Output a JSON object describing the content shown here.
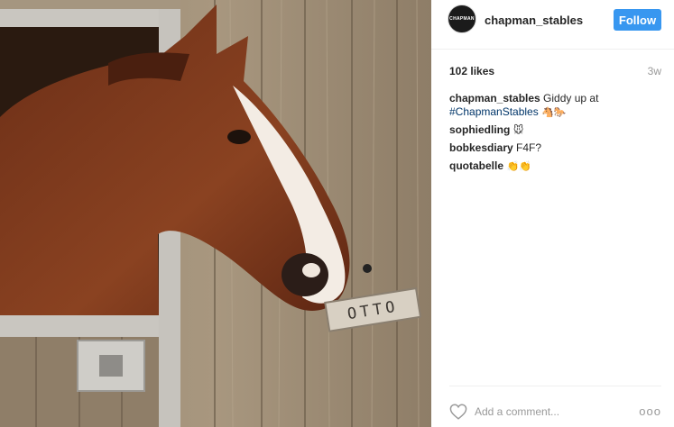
{
  "post": {
    "username": "chapman_stables",
    "avatar_text": "CHAPMAN",
    "follow_label": "Follow",
    "likes": "102 likes",
    "time": "3w",
    "caption_user": "chapman_stables",
    "caption_text": " Giddy up at ",
    "caption_hashtag": "#ChapmanStables",
    "caption_emoji": " 🐴🐎"
  },
  "comments": [
    {
      "user": "sophiedling",
      "text": " 🐭"
    },
    {
      "user": "bobkesdiary",
      "text": " F4F?"
    },
    {
      "user": "quotabelle",
      "text": " 👏👏"
    }
  ],
  "footer": {
    "add_comment_placeholder": "Add a comment...",
    "more_label": "ooo"
  },
  "photo": {
    "sign_text": "OTTO"
  },
  "colors": {
    "accent": "#3897f0",
    "hashtag": "#003569",
    "muted": "#999999"
  }
}
